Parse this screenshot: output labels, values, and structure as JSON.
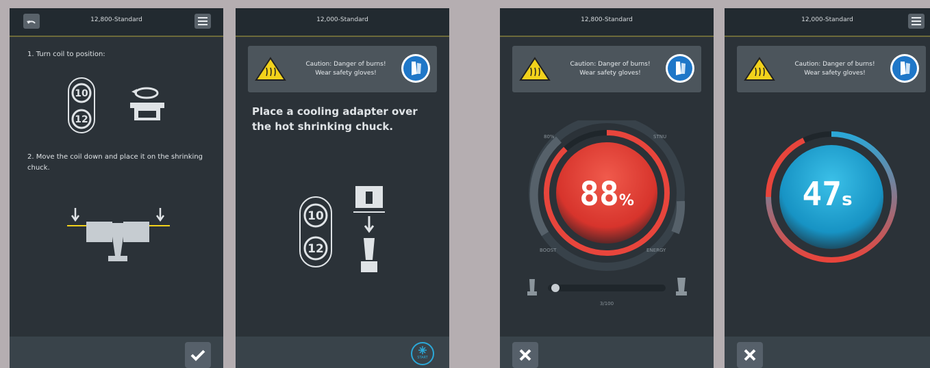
{
  "panels": [
    {
      "title": "12,800-Standard",
      "step1": "1. Turn coil to position:",
      "step2": "2. Move the coil down and place it on the shrinking chuck.",
      "coil_sizes": [
        "10",
        "12"
      ]
    },
    {
      "title": "12,000-Standard",
      "caution_line1": "Caution: Danger of burns!",
      "caution_line2": "Wear safety gloves!",
      "instruction": "Place a cooling adapter over the hot shrinking chuck.",
      "coil_sizes": [
        "10",
        "12"
      ],
      "start_label": "START"
    },
    {
      "title": "12,800-Standard",
      "caution_line1": "Caution: Danger of burns!",
      "caution_line2": "Wear safety gloves!",
      "value": "88",
      "unit": "%",
      "progress_fraction": 0.88,
      "gauge_labels": {
        "top_left": "80%",
        "top_right": "STNU",
        "bottom_left": "BOOST",
        "bottom_right": "ENERGY"
      },
      "slider_fraction": 0.03,
      "slider_caption": "3/100"
    },
    {
      "title": "12,000-Standard",
      "caution_line1": "Caution: Danger of burns!",
      "caution_line2": "Wear safety gloves!",
      "value": "47",
      "unit": "s"
    }
  ],
  "colors": {
    "background": "#b5aeb1",
    "panel": "#2b3238",
    "accent_red": "#e8453c",
    "accent_blue": "#2ba8d8",
    "warning_yellow": "#f2d21b"
  }
}
